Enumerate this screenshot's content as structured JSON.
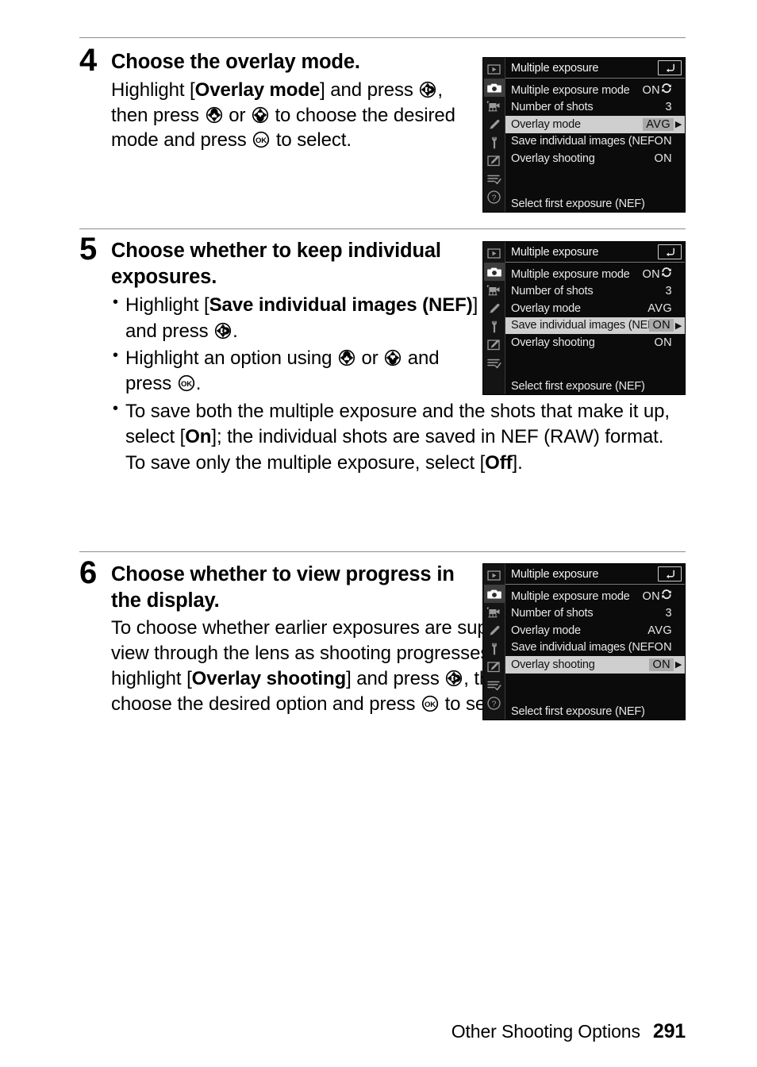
{
  "document": {
    "footer": {
      "chapter": "Other Shooting Options",
      "page_number": "291"
    }
  },
  "steps": [
    {
      "number": "4",
      "title": "Choose the overlay mode.",
      "body_html": "Highlight [<b>Overlay mode</b>] and press <span class=\"glyph multi\" data-name=\"multi-selector-right-icon\" data-interactable=\"false\"></span>, then press <span class=\"glyph multi up\" data-name=\"multi-selector-up-icon\" data-interactable=\"false\"></span> or <span class=\"glyph multi down\" data-name=\"multi-selector-down-icon\" data-interactable=\"false\"></span> to choose the desired mode and press <span class=\"glyph okg\" data-name=\"ok-button-icon\" data-interactable=\"false\"></span> to select."
    },
    {
      "number": "5",
      "title": "Choose whether to keep individual exposures.",
      "bullets_html": [
        "Highlight [<b>Save individual images (NEF)</b>] and press <span class=\"glyph multi\" data-name=\"multi-selector-right-icon\" data-interactable=\"false\"></span>.",
        "Highlight an option using <span class=\"glyph multi up\" data-name=\"multi-selector-up-icon\" data-interactable=\"false\"></span> or <span class=\"glyph multi down\" data-name=\"multi-selector-down-icon\" data-interactable=\"false\"></span> and press <span class=\"glyph okg\" data-name=\"ok-button-icon\" data-interactable=\"false\"></span>.",
        "To save both the multiple exposure and the shots that make it up, select [<b>On</b>]; the individual shots are saved in NEF (RAW) format. To save only the multiple exposure, select [<b>Off</b>]."
      ]
    },
    {
      "number": "6",
      "title": "Choose whether to view progress in the display.",
      "body_html": "To choose whether earlier exposures are superimposed over the view through the lens as shooting progresses (live view only), highlight [<b>Overlay shooting</b>] and press <span class=\"glyph multi\" data-name=\"multi-selector-right-icon\" data-interactable=\"false\"></span>, then press <span class=\"glyph multi up\" data-name=\"multi-selector-up-icon\" data-interactable=\"false\"></span> or <span class=\"glyph multi down\" data-name=\"multi-selector-down-icon\" data-interactable=\"false\"></span> to choose the desired option and press <span class=\"glyph okg\" data-name=\"ok-button-icon\" data-interactable=\"false\"></span> to select."
    }
  ],
  "menus": [
    {
      "id": "menu-step-4",
      "title": "Multiple exposure",
      "back_icon": "return-arrow-icon",
      "sidebar_icons": [
        "playback-icon",
        "photo-shooting-menu-icon",
        "movie-shooting-menu-icon",
        "custom-settings-icon",
        "setup-menu-icon",
        "retouch-menu-icon",
        "my-menu-icon",
        "help-icon"
      ],
      "selected_sidebar_index": 1,
      "rows": [
        {
          "label": "Multiple exposure mode",
          "value": "ON",
          "value_has_cycle_icon": true,
          "highlighted": false
        },
        {
          "label": "Number of shots",
          "value": "3",
          "value_has_cycle_icon": false,
          "highlighted": false
        },
        {
          "label": "Overlay mode",
          "value": "AVG",
          "value_has_cycle_icon": false,
          "highlighted": true
        },
        {
          "label": "Save individual images (NEF)",
          "value": "ON",
          "value_has_cycle_icon": false,
          "highlighted": false
        },
        {
          "label": "Overlay shooting",
          "value": "ON",
          "value_has_cycle_icon": false,
          "highlighted": false
        }
      ],
      "footer_item": "Select first exposure (NEF)"
    },
    {
      "id": "menu-step-5",
      "title": "Multiple exposure",
      "back_icon": "return-arrow-icon",
      "sidebar_icons": [
        "playback-icon",
        "photo-shooting-menu-icon",
        "movie-shooting-menu-icon",
        "custom-settings-icon",
        "setup-menu-icon",
        "retouch-menu-icon",
        "my-menu-icon"
      ],
      "selected_sidebar_index": 1,
      "rows": [
        {
          "label": "Multiple exposure mode",
          "value": "ON",
          "value_has_cycle_icon": true,
          "highlighted": false
        },
        {
          "label": "Number of shots",
          "value": "3",
          "value_has_cycle_icon": false,
          "highlighted": false
        },
        {
          "label": "Overlay mode",
          "value": "AVG",
          "value_has_cycle_icon": false,
          "highlighted": false
        },
        {
          "label": "Save individual images (NEF)",
          "value": "ON",
          "value_has_cycle_icon": false,
          "highlighted": true
        },
        {
          "label": "Overlay shooting",
          "value": "ON",
          "value_has_cycle_icon": false,
          "highlighted": false
        }
      ],
      "footer_item": "Select first exposure (NEF)"
    },
    {
      "id": "menu-step-6",
      "title": "Multiple exposure",
      "back_icon": "return-arrow-icon",
      "sidebar_icons": [
        "playback-icon",
        "photo-shooting-menu-icon",
        "movie-shooting-menu-icon",
        "custom-settings-icon",
        "setup-menu-icon",
        "retouch-menu-icon",
        "my-menu-icon",
        "help-icon"
      ],
      "selected_sidebar_index": 1,
      "rows": [
        {
          "label": "Multiple exposure mode",
          "value": "ON",
          "value_has_cycle_icon": true,
          "highlighted": false
        },
        {
          "label": "Number of shots",
          "value": "3",
          "value_has_cycle_icon": false,
          "highlighted": false
        },
        {
          "label": "Overlay mode",
          "value": "AVG",
          "value_has_cycle_icon": false,
          "highlighted": false
        },
        {
          "label": "Save individual images (NEF)",
          "value": "ON",
          "value_has_cycle_icon": false,
          "highlighted": false
        },
        {
          "label": "Overlay shooting",
          "value": "ON",
          "value_has_cycle_icon": false,
          "highlighted": true
        }
      ],
      "footer_item": "Select first exposure (NEF)"
    }
  ],
  "colors": {
    "lcd_background": "#0b0b0b",
    "lcd_sidebar": "#141414",
    "highlight_row": "#cfcfcf",
    "highlight_value": "#a9a9a9",
    "rule": "#8c8c8c"
  }
}
